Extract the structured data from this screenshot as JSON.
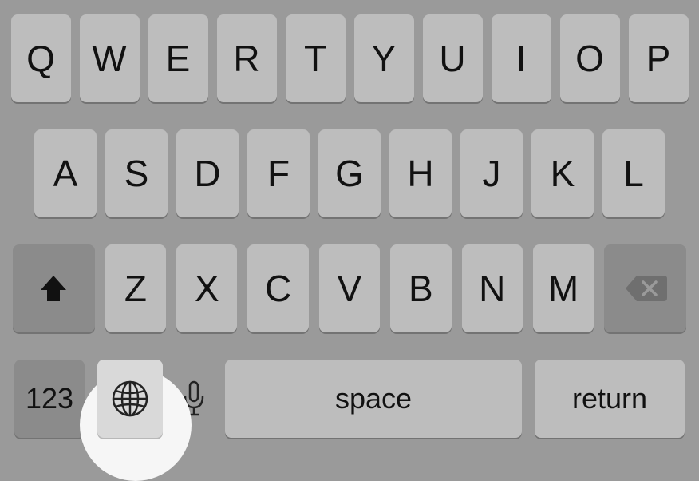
{
  "keyboard": {
    "row1": [
      "Q",
      "W",
      "E",
      "R",
      "T",
      "Y",
      "U",
      "I",
      "O",
      "P"
    ],
    "row2": [
      "A",
      "S",
      "D",
      "F",
      "G",
      "H",
      "J",
      "K",
      "L"
    ],
    "row3": [
      "Z",
      "X",
      "C",
      "V",
      "B",
      "N",
      "M"
    ],
    "numeric_label": "123",
    "space_label": "space",
    "return_label": "return"
  }
}
